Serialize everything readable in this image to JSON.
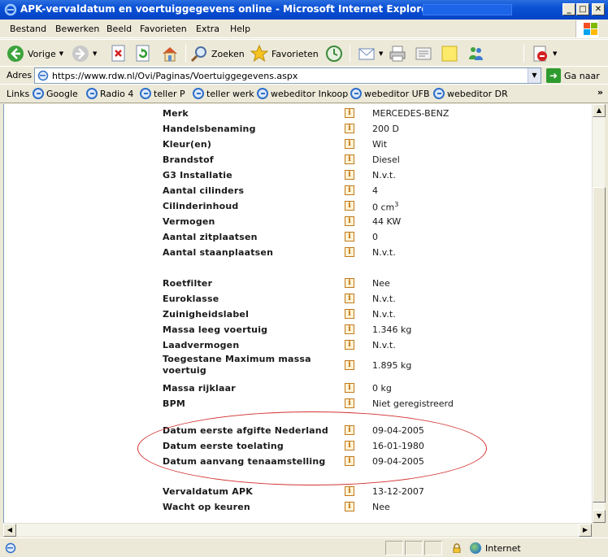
{
  "window": {
    "title": "APK-vervaldatum en voertuiggegevens online - Microsoft Internet Explorer provided by"
  },
  "menu": [
    "Bestand",
    "Bewerken",
    "Beeld",
    "Favorieten",
    "Extra",
    "Help"
  ],
  "toolbar": {
    "back_label": "Vorige",
    "search_label": "Zoeken",
    "favorites_label": "Favorieten"
  },
  "address": {
    "label": "Adres",
    "url": "https://www.rdw.nl/Ovi/Paginas/Voertuiggegevens.aspx",
    "go_label": "Ga naar"
  },
  "links": {
    "label": "Links",
    "items": [
      "Google",
      "Radio 4",
      "teller P",
      "teller werk",
      "webeditor Inkoop",
      "webeditor UFB",
      "webeditor DR"
    ]
  },
  "vehicle": {
    "group1": [
      {
        "label": "Merk",
        "value": "MERCEDES-BENZ"
      },
      {
        "label": "Handelsbenaming",
        "value": "200 D"
      },
      {
        "label": "Kleur(en)",
        "value": "Wit"
      },
      {
        "label": "Brandstof",
        "value": "Diesel"
      },
      {
        "label": "G3 Installatie",
        "value": "N.v.t."
      },
      {
        "label": "Aantal cilinders",
        "value": "4"
      },
      {
        "label": "Cilinderinhoud",
        "value": "0 cm",
        "sup": "3"
      },
      {
        "label": "Vermogen",
        "value": "44 KW"
      },
      {
        "label": "Aantal zitplaatsen",
        "value": "0"
      },
      {
        "label": "Aantal staanplaatsen",
        "value": "N.v.t."
      }
    ],
    "group2": [
      {
        "label": "Roetfilter",
        "value": "Nee"
      },
      {
        "label": "Euroklasse",
        "value": "N.v.t."
      },
      {
        "label": "Zuinigheidslabel",
        "value": "N.v.t."
      },
      {
        "label": "Massa leeg voertuig",
        "value": "1.346 kg"
      },
      {
        "label": "Laadvermogen",
        "value": "N.v.t."
      },
      {
        "label": "Toegestane Maximum massa voertuig",
        "value": "1.895 kg"
      },
      {
        "label": "Massa rijklaar",
        "value": "0 kg"
      },
      {
        "label": "BPM",
        "value": "Niet geregistreerd"
      }
    ],
    "group3": [
      {
        "label": "Datum eerste afgifte Nederland",
        "value": "09-04-2005"
      },
      {
        "label": "Datum eerste toelating",
        "value": "16-01-1980"
      },
      {
        "label": "Datum aanvang tenaamstelling",
        "value": "09-04-2005"
      }
    ],
    "group4": [
      {
        "label": "Vervaldatum APK",
        "value": "13-12-2007"
      },
      {
        "label": "Wacht op keuren",
        "value": "Nee"
      }
    ],
    "info_glyph": "i"
  },
  "status": {
    "zone": "Internet"
  },
  "colors": {
    "titlebar": "#0A50D5",
    "chrome": "#ECE9D8",
    "highlight_ellipse": "#D43030",
    "info_icon": "#C06A00"
  }
}
